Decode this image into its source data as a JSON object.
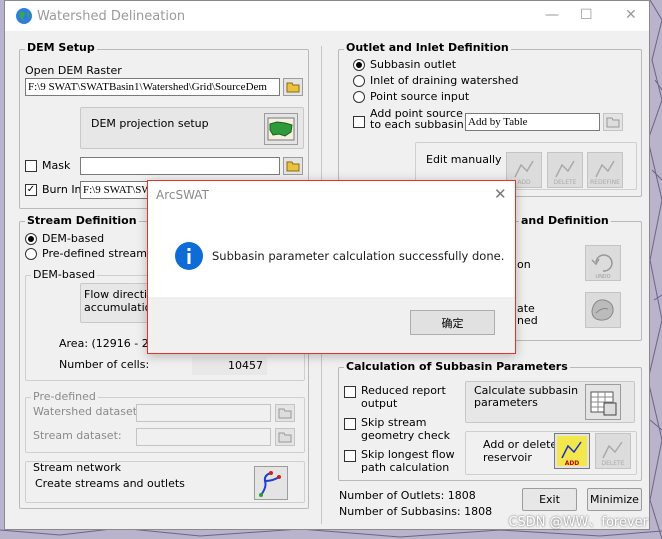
{
  "window": {
    "title": "Watershed Delineation"
  },
  "dem_setup": {
    "title": "DEM Setup",
    "open_dem_label": "Open DEM Raster",
    "dem_path": "F:\\9 SWAT\\SWATBasin1\\Watershed\\Grid\\SourceDem",
    "projection_label": "DEM projection setup",
    "mask_label": "Mask",
    "mask_checked": false,
    "burnin_label": "Burn In",
    "burnin_checked": true,
    "burnin_path": "F:\\9 SWAT\\SWAT"
  },
  "stream_def": {
    "title": "Stream Definition",
    "option_dem": "DEM-based",
    "option_predef": "Pre-defined streams",
    "selected": "DEM-based",
    "dem_based_title": "DEM-based",
    "flow_text_line1": "Flow directio",
    "flow_text_line2": "accumulation",
    "area_label": "Area: (12916 - 258",
    "cells_label": "Number of cells:",
    "cells_value": "10457",
    "predefined_title": "Pre-defined",
    "watershed_dataset_label": "Watershed dataset:",
    "stream_dataset_label": "Stream dataset:",
    "network_title": "Stream network",
    "network_label": "Create streams and outlets"
  },
  "outlet_inlet": {
    "title": "Outlet and Inlet Definition",
    "opt_subbasin_outlet": "Subbasin outlet",
    "opt_inlet_draining": "Inlet of draining watershed",
    "opt_point_source": "Point source input",
    "selected": "Subbasin outlet",
    "add_point_line1": "Add point source",
    "add_point_line2": "to each subbasin",
    "add_point_checked": false,
    "add_by_table": "Add by Table",
    "edit_manually": "Edit manually",
    "add_icon_label": "ADD",
    "delete_icon_label": "DELETE",
    "redefine_icon_label": "REDEFINE"
  },
  "watershed_outlet": {
    "title_fragment": "and Definition",
    "line1_fragment": "on",
    "line2a_fragment": "ate",
    "line2b_fragment": "ned",
    "undo_label": "UNDO"
  },
  "calc": {
    "title": "Calculation of Subbasin Parameters",
    "reduced_line1": "Reduced  report",
    "reduced_line2": "output",
    "skip_stream_line1": "Skip stream",
    "skip_stream_line2": "geometry check",
    "skip_longest_line1": "Skip longest flow",
    "skip_longest_line2": "path calculation",
    "calc_btn_line1": "Calculate subbasin",
    "calc_btn_line2": "parameters",
    "add_delete_line1": "Add or delete",
    "add_delete_line2": "reservoir",
    "add_icon_label": "ADD",
    "delete_icon_label": "DELETE"
  },
  "footer": {
    "outlets_label": "Number of Outlets: 1808",
    "subbasins_label": "Number of Subbasins: 1808",
    "exit_label": "Exit",
    "minimize_label": "Minimize"
  },
  "dialog": {
    "title": "ArcSWAT",
    "message": "Subbasin parameter calculation successfully done.",
    "ok_label": "确定"
  },
  "watermark": "CSDN @WW、forever",
  "colors": {
    "accent_red": "#e5332a",
    "info_blue": "#0f6cd6",
    "map_bg": "#b7b1c9"
  }
}
